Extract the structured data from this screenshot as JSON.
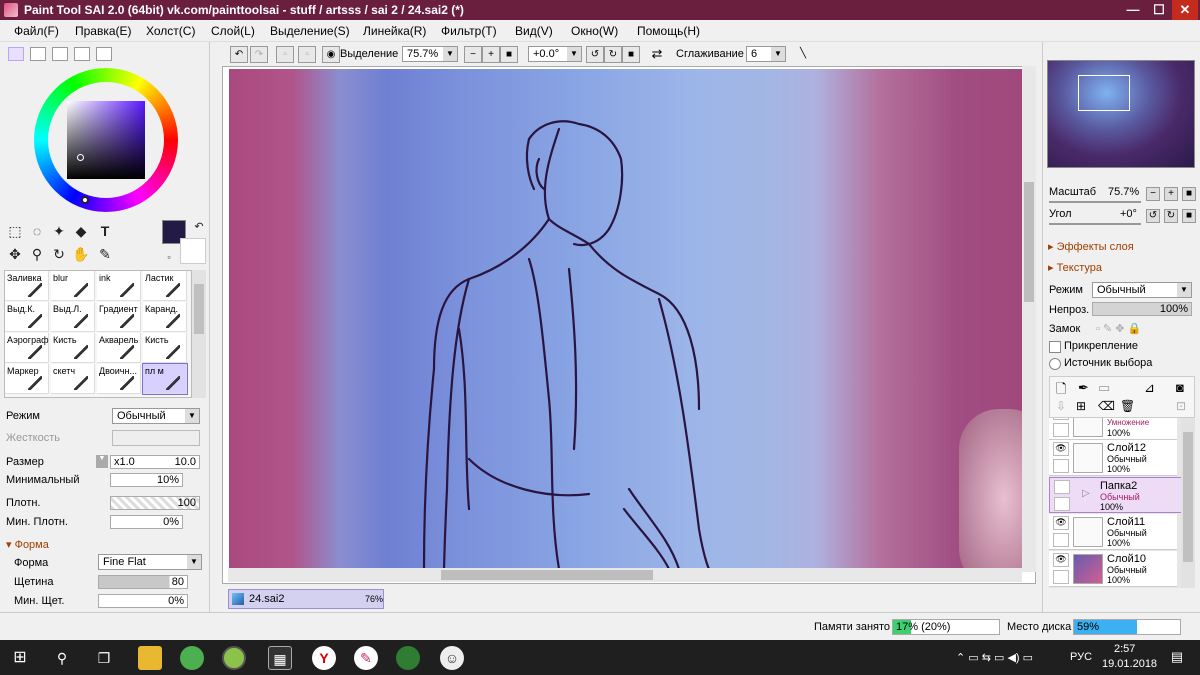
{
  "window": {
    "title": "Paint Tool SAI 2.0 (64bit) vk.com/painttoolsai - stuff / artsss / sai 2 / 24.sai2 (*)",
    "controls": {
      "minimize": "—",
      "maximize": "☐",
      "close": "✕"
    }
  },
  "menu": [
    "Файл(F)",
    "Правка(E)",
    "Холст(C)",
    "Слой(L)",
    "Выделение(S)",
    "Линейка(R)",
    "Фильтр(T)",
    "Вид(V)",
    "Окно(W)",
    "Помощь(H)"
  ],
  "toolbar": {
    "selection_label": "Выделение",
    "zoom_value": "75.7%",
    "angle_value": "+0.0°",
    "smoothing_label": "Сглаживание",
    "smoothing_value": "6"
  },
  "colors": {
    "current": "#231a45",
    "secondary": "#ffffff",
    "titlebar": "#6b1f3f"
  },
  "brushes": [
    {
      "label": "Заливка"
    },
    {
      "label": "blur"
    },
    {
      "label": "ink"
    },
    {
      "label": "Ластик"
    },
    {
      "label": "Выд.К."
    },
    {
      "label": "Выд.Л."
    },
    {
      "label": "Градиент"
    },
    {
      "label": "Каранд."
    },
    {
      "label": "Аэрограф"
    },
    {
      "label": "Кисть"
    },
    {
      "label": "Акварель"
    },
    {
      "label": "Кисть"
    },
    {
      "label": "Маркер"
    },
    {
      "label": "скетч"
    },
    {
      "label": "Двоичн..."
    },
    {
      "label": "пл м"
    }
  ],
  "brush_props": {
    "mode_label": "Режим",
    "mode_value": "Обычный",
    "hardness_label": "Жесткость",
    "size_label": "Размер",
    "size_mult": "x1.0",
    "size_value": "10.0",
    "min_label": "Минимальный",
    "min_value": "10%",
    "density_label": "Плотн.",
    "density_value": "100",
    "min_density_label": "Мин. Плотн.",
    "min_density_value": "0%",
    "shape_section": "Форма",
    "shape_label": "Форма",
    "shape_value": "Fine Flat",
    "bristle_label": "Щетина",
    "bristle_value": "80",
    "min_bristle_label": "Мин. Щет.",
    "min_bristle_value": "0%"
  },
  "document_tab": {
    "name": "24.sai2",
    "zoom": "76%"
  },
  "navigator": {
    "zoom_label": "Масштаб",
    "zoom_value": "75.7%",
    "angle_label": "Угол",
    "angle_value": "+0°"
  },
  "layer_panel": {
    "effects_label": "Эффекты слоя",
    "texture_label": "Текстура",
    "mode_label": "Режим",
    "mode_value": "Обычный",
    "opacity_label": "Непроз.",
    "opacity_value": "100%",
    "lock_label": "Замок",
    "clip_label": "Прикрепление",
    "source_label": "Источник выбора",
    "layers": [
      {
        "name": "Умножение",
        "mode": "100%",
        "opacity": "",
        "visible": false,
        "partial": true
      },
      {
        "name": "Слой12",
        "mode": "Обычный",
        "opacity": "100%",
        "visible": true
      },
      {
        "name": "Папка2",
        "mode": "Обычный",
        "opacity": "100%",
        "visible": false,
        "folder": true
      },
      {
        "name": "Слой11",
        "mode": "Обычный",
        "opacity": "100%",
        "visible": true
      },
      {
        "name": "Слой10",
        "mode": "Обычный",
        "opacity": "100%",
        "visible": true
      }
    ]
  },
  "status": {
    "memory_label": "Памяти занято",
    "memory_value": "17% (20%)",
    "memory_fraction": 0.17,
    "disk_label": "Место диска",
    "disk_value": "59%",
    "disk_fraction": 0.59
  },
  "taskbar": {
    "language": "РУС",
    "time": "2:57",
    "date": "19.01.2018"
  }
}
